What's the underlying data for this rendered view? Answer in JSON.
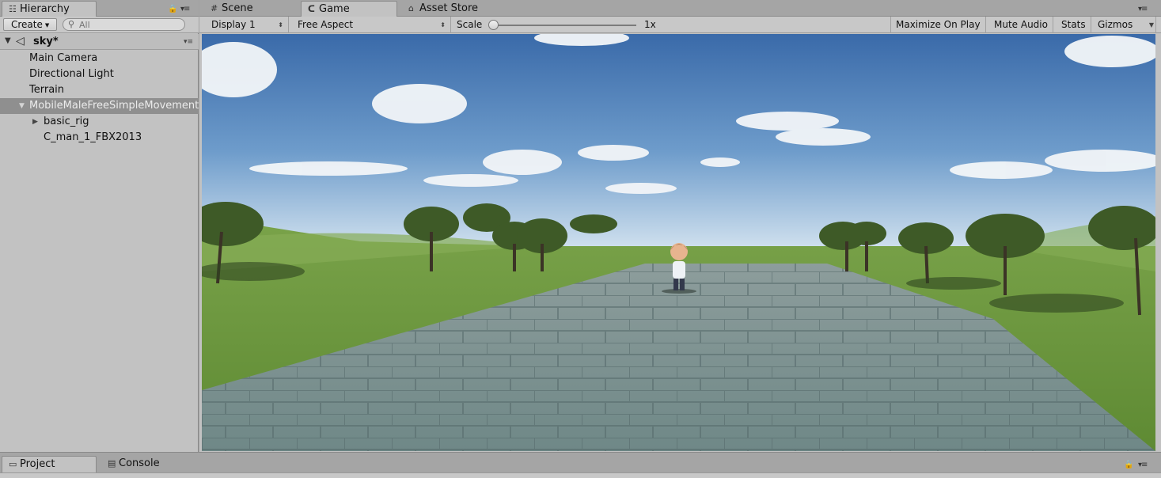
{
  "hierarchy": {
    "tab_label": "Hierarchy",
    "create_label": "Create",
    "search_placeholder": "All",
    "scene_name": "sky*",
    "items": [
      {
        "label": "Main Camera"
      },
      {
        "label": "Directional Light"
      },
      {
        "label": "Terrain"
      },
      {
        "label": "MobileMaleFreeSimpleMovement",
        "selected": true,
        "expanded": true
      },
      {
        "label": "basic_rig",
        "collapsed_children": true
      },
      {
        "label": "C_man_1_FBX2013"
      }
    ]
  },
  "game_tabs": [
    {
      "label": "Scene",
      "icon": "grid-icon"
    },
    {
      "label": "Game",
      "icon": "pacman-icon",
      "active": true
    },
    {
      "label": "Asset Store",
      "icon": "store-bag-icon"
    }
  ],
  "game_toolbar": {
    "display": "Display 1",
    "aspect": "Free Aspect",
    "scale_label": "Scale",
    "scale_value": "1x",
    "maximize_on_play": "Maximize On Play",
    "mute_audio": "Mute Audio",
    "stats": "Stats",
    "gizmos": "Gizmos"
  },
  "bottom_tabs": [
    {
      "label": "Project",
      "icon": "folder-icon",
      "active": true
    },
    {
      "label": "Console",
      "icon": "console-icon"
    }
  ],
  "colors": {
    "sky_top": "#3f70ae",
    "sky_horizon": "#c9dceb",
    "grass": "#6f9a3e",
    "path_stone": "#7d9292",
    "selection": "#8f8f8f"
  }
}
